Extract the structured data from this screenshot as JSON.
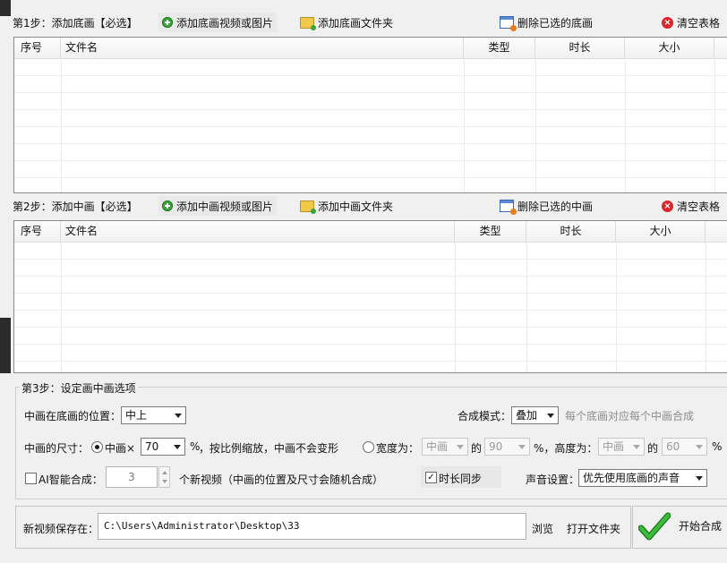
{
  "step1": {
    "label": "第1步：添加底画【必选】",
    "add_video_label": "添加底画视频或图片",
    "add_folder_label": "添加底画文件夹",
    "delete_selected_label": "删除已选的底画",
    "clear_table_label": "清空表格",
    "columns": [
      "序号",
      "文件名",
      "类型",
      "时长",
      "大小"
    ]
  },
  "step2": {
    "label": "第2步：添加中画【必选】",
    "add_video_label": "添加中画视频或图片",
    "add_folder_label": "添加中画文件夹",
    "delete_selected_label": "删除已选的中画",
    "clear_table_label": "清空表格",
    "columns": [
      "序号",
      "文件名",
      "类型",
      "时长",
      "大小"
    ]
  },
  "step3": {
    "title": "第3步：设定画中画选项",
    "position_label": "中画在底画的位置：",
    "position_value": "中上",
    "mode_label": "合成模式：",
    "mode_value": "叠加",
    "mode_hint": "每个底画对应每个中画合成",
    "size_label": "中画的尺寸：",
    "scale_option_label": "中画×",
    "scale_value": "70",
    "percent_sign": "%",
    "scale_hint": "，按比例缩放，中画不会变形",
    "width_option_label": "宽度为：",
    "width_ref_value": "中画",
    "of_label": "的",
    "width_pct_value": "90",
    "height_label": "%，高度为：",
    "height_ref_value": "中画",
    "of_label2": "的",
    "height_pct_value": "60",
    "percent_sign2": "%",
    "ai_label": "AI智能合成：",
    "ai_count_value": "3",
    "ai_hint": "个新视频（中画的位置及尺寸会随机合成）",
    "duration_sync_label": "时长同步",
    "sound_label": "声音设置：",
    "sound_value": "优先使用底画的声音"
  },
  "output": {
    "save_label": "新视频保存在：",
    "path_value": "C:\\Users\\Administrator\\Desktop\\33",
    "browse_label": "浏览",
    "open_folder_label": "打开文件夹",
    "start_label": "开始合成"
  },
  "state": {
    "scale_option_selected": true,
    "width_option_selected": false,
    "ai_enabled": false,
    "duration_sync_checked": true
  },
  "colors": {
    "window_bg": "#f0f0f0",
    "grid_border": "#8a8a8a",
    "check_green": "#2fa12f",
    "clear_red": "#d8262d"
  }
}
